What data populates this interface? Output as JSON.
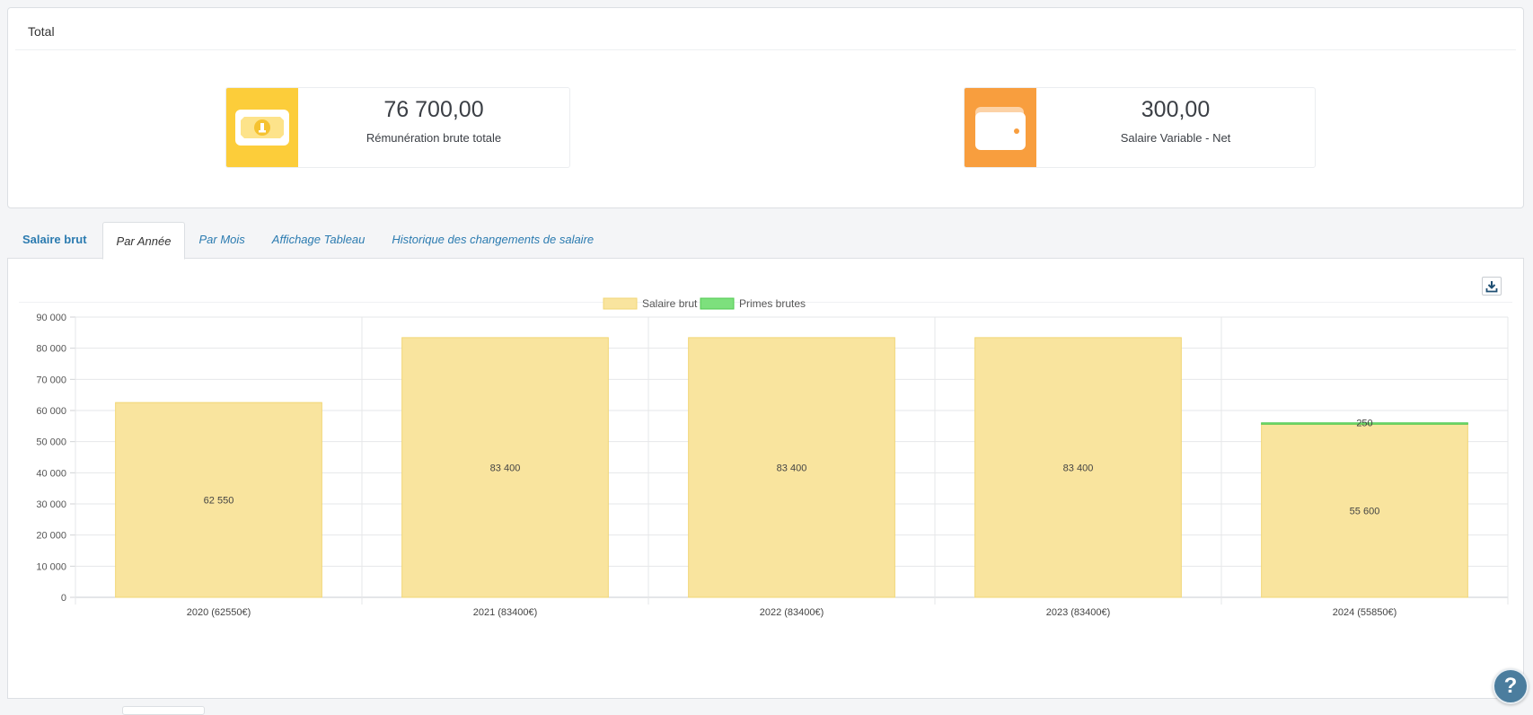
{
  "total": {
    "header": "Total",
    "cards": [
      {
        "value": "76 700,00",
        "label": "Rémunération brute totale",
        "icon": "banknote-icon",
        "color": "#fccd3a"
      },
      {
        "value": "300,00",
        "label": "Salaire Variable - Net",
        "icon": "wallet-icon",
        "color": "#f89e3e"
      }
    ]
  },
  "tabs": {
    "title": "Salaire brut",
    "items": [
      {
        "label": "Par Année",
        "active": true
      },
      {
        "label": "Par Mois",
        "active": false
      },
      {
        "label": "Affichage Tableau",
        "active": false
      },
      {
        "label": "Historique des changements de salaire",
        "active": false
      }
    ]
  },
  "toolbar": {
    "download_icon": "download-icon"
  },
  "help": {
    "label": "?"
  },
  "chart_data": {
    "type": "bar",
    "stacked": true,
    "categories": [
      "2020 (62550€)",
      "2021 (83400€)",
      "2022 (83400€)",
      "2023 (83400€)",
      "2024 (55850€)"
    ],
    "series": [
      {
        "name": "Salaire brut",
        "values": [
          62550,
          83400,
          83400,
          83400,
          55600
        ],
        "labels": [
          "62 550",
          "83 400",
          "83 400",
          "83 400",
          "55 600"
        ],
        "color": "#f9e49e",
        "border": "#f1d675"
      },
      {
        "name": "Primes brutes",
        "values": [
          0,
          0,
          0,
          0,
          250
        ],
        "labels": [
          "",
          "",
          "",
          "",
          "250"
        ],
        "color": "#7de07d",
        "border": "#4fc94f"
      }
    ],
    "ylim": [
      0,
      90000
    ],
    "yticks": [
      "0",
      "10 000",
      "20 000",
      "30 000",
      "40 000",
      "50 000",
      "60 000",
      "70 000",
      "80 000",
      "90 000"
    ],
    "legend_position": "top-center",
    "grid": true
  }
}
